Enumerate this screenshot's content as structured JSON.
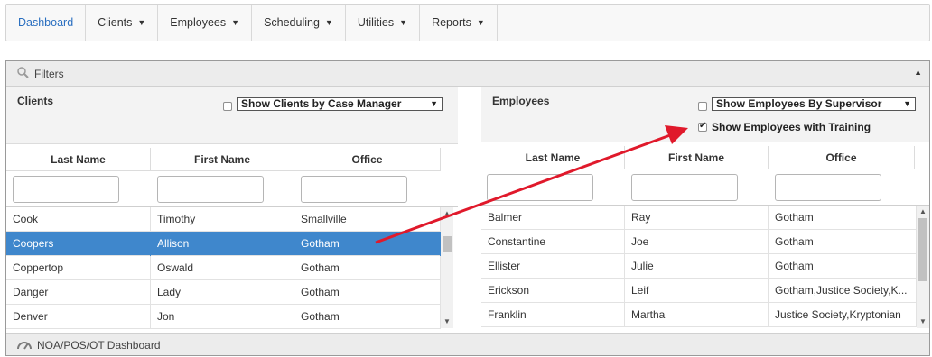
{
  "nav": {
    "items": [
      {
        "label": "Dashboard",
        "caret": "",
        "active": true
      },
      {
        "label": "Clients",
        "caret": "▼"
      },
      {
        "label": "Employees",
        "caret": "▼"
      },
      {
        "label": "Scheduling",
        "caret": "▼"
      },
      {
        "label": "Utilities",
        "caret": "▼"
      },
      {
        "label": "Reports",
        "caret": "▼"
      }
    ]
  },
  "filters": {
    "label": "Filters",
    "collapse_glyph": "▲"
  },
  "clients": {
    "title": "Clients",
    "case_manager_checked": false,
    "case_manager_select": "Show Clients by Case Manager",
    "columns": [
      "Last Name",
      "First Name",
      "Office"
    ],
    "rows": [
      {
        "last": "Cook",
        "first": "Timothy",
        "office": "Smallville"
      },
      {
        "last": "Coopers",
        "first": "Allison",
        "office": "Gotham",
        "selected": true
      },
      {
        "last": "Coppertop",
        "first": "Oswald",
        "office": "Gotham"
      },
      {
        "last": "Danger",
        "first": "Lady",
        "office": "Gotham"
      },
      {
        "last": "Denver",
        "first": "Jon",
        "office": "Gotham"
      }
    ],
    "scroll_position": 0.2
  },
  "employees": {
    "title": "Employees",
    "supervisor_checked": false,
    "supervisor_select": "Show Employees By Supervisor",
    "training_checked": true,
    "training_label": "Show Employees with Training",
    "columns": [
      "Last Name",
      "First Name",
      "Office"
    ],
    "rows": [
      {
        "last": "Balmer",
        "first": "Ray",
        "office": "Gotham"
      },
      {
        "last": "Constantine",
        "first": "Joe",
        "office": "Gotham"
      },
      {
        "last": "Ellister",
        "first": "Julie",
        "office": "Gotham"
      },
      {
        "last": "Erickson",
        "first": "Leif",
        "office": "Gotham,Justice Society,K..."
      },
      {
        "last": "Franklin",
        "first": "Martha",
        "office": "Justice Society,Kryptonian"
      }
    ],
    "scroll_position": 0.0
  },
  "bottom": {
    "label": "NOA/POS/OT Dashboard"
  },
  "colors": {
    "accent": "#2a6fc0",
    "selected_row": "#3f87cc",
    "annotation_arrow": "#e0192b"
  },
  "icons": {
    "filters": "magnifier-icon",
    "bottom": "speedometer-icon",
    "select_arrow": "▼",
    "scroll_up": "▲",
    "scroll_down": "▼"
  }
}
